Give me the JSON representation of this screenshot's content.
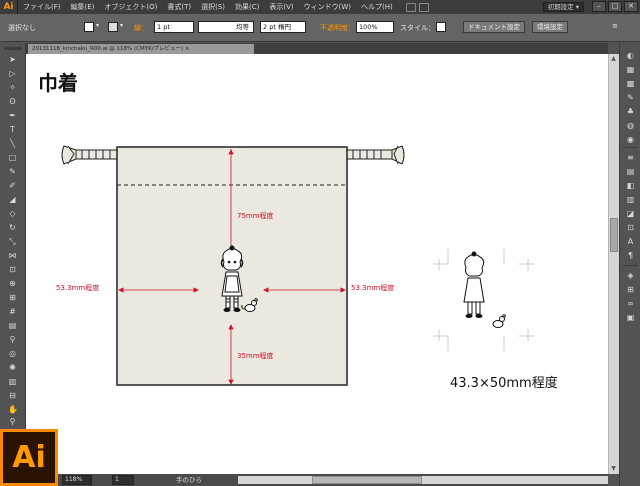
{
  "app": {
    "logo_text": "Ai",
    "menu": [
      "ファイル(F)",
      "編集(E)",
      "オブジェクト(O)",
      "書式(T)",
      "選択(S)",
      "効果(C)",
      "表示(V)",
      "ウィンドウ(W)",
      "ヘルプ(H)"
    ],
    "workspace": "初期設定 ▾",
    "window_controls": [
      "–",
      "□",
      "✕"
    ]
  },
  "control_bar": {
    "selection": "選択なし",
    "stroke_label": "線：",
    "stroke_weight": "1 pt",
    "stroke_profile": "均等",
    "brush": "2 pt 楕円",
    "opacity_label": "不透明度：",
    "opacity_value": "100%",
    "style_label": "スタイル：",
    "document_setup_button": "ドキュメント設定",
    "preferences_button": "環境設定",
    "accent_color": "#ff9a00"
  },
  "document_tab": {
    "label": "20131118_kinchaku_R00.ai @ 118% (CMYK/プレビュー) ×"
  },
  "canvas": {
    "title": "巾着",
    "dimensions": {
      "top": "75mm程度",
      "bottom": "35mm程度",
      "left": "53.3mm程度",
      "right": "53.3mm程度"
    },
    "print_size_label": "43.3×50mm程度",
    "dimension_color": "#d0102a",
    "bag_color": "#ebe8e0"
  },
  "status_bar": {
    "zoom": "118%",
    "page": "1",
    "tool_name": "手のひら"
  },
  "big_logo_text": "Ai"
}
